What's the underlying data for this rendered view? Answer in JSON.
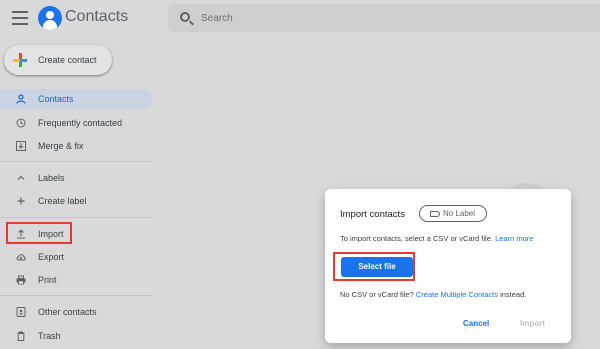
{
  "header": {
    "app_title": "Contacts",
    "search_placeholder": "Search"
  },
  "sidebar": {
    "create_label": "Create contact",
    "items": [
      {
        "label": "Contacts",
        "icon": "person-icon"
      },
      {
        "label": "Frequently contacted",
        "icon": "history-icon"
      },
      {
        "label": "Merge & fix",
        "icon": "merge-icon"
      },
      {
        "label": "Labels",
        "icon": "chevron-up-icon"
      },
      {
        "label": "Create label",
        "icon": "plus-icon"
      },
      {
        "label": "Import",
        "icon": "upload-icon"
      },
      {
        "label": "Export",
        "icon": "cloud-download-icon"
      },
      {
        "label": "Print",
        "icon": "print-icon"
      },
      {
        "label": "Other contacts",
        "icon": "contacts-book-icon"
      },
      {
        "label": "Trash",
        "icon": "trash-icon"
      }
    ]
  },
  "dialog": {
    "title": "Import contacts",
    "label_chip": "No Label",
    "desc": "To import contacts, select a CSV or vCard file.",
    "learn_more": "Learn more",
    "select_file": "Select file",
    "note_prefix": "No CSV or vCard file?",
    "note_link": "Create Multiple Contacts",
    "note_suffix": "instead.",
    "cancel": "Cancel",
    "import": "Import"
  },
  "colors": {
    "accent": "#1a73e8",
    "highlight": "#e53935"
  }
}
